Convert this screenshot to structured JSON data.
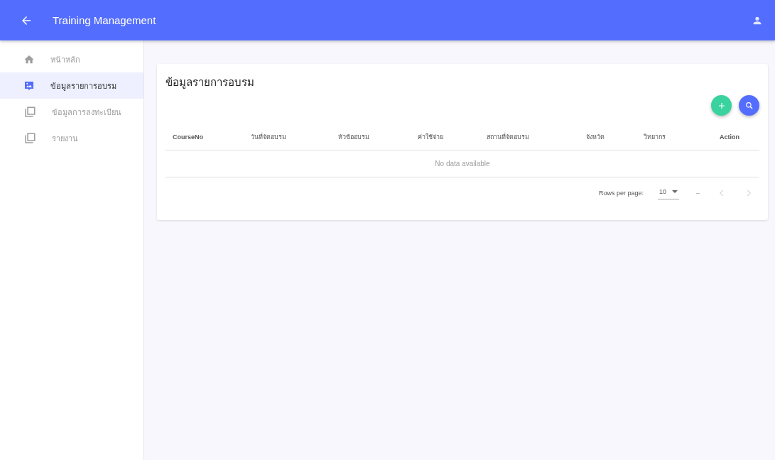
{
  "app_bar": {
    "title": "Training Management"
  },
  "sidebar": {
    "items": [
      {
        "label": "หน้าหลัก",
        "kind": "home",
        "selected": false
      },
      {
        "label": "ข้อมูลรายการอบรม",
        "kind": "image",
        "selected": true
      },
      {
        "label": "ข้อมูลการลงทะเบียน",
        "kind": "copy",
        "selected": false
      },
      {
        "label": "รายงาน",
        "kind": "copy",
        "selected": false
      }
    ]
  },
  "card": {
    "title": "ข้อมูลรายการอบรม",
    "table": {
      "columns": [
        "CourseNo",
        "วันที่จัดอบรม",
        "หัวข้ออบรม",
        "ค่าใช้จ่าย",
        "สถานที่จัดอบรม",
        "จังหวัด",
        "วิทยากร",
        "Action"
      ],
      "empty_text": "No data available"
    },
    "footer": {
      "rows_per_page_label": "Rows per page:",
      "rows_per_page": "10",
      "range": "–"
    }
  }
}
